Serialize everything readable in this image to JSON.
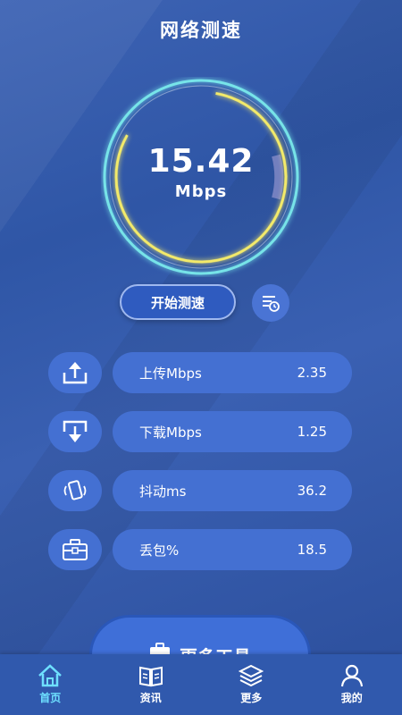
{
  "header": {
    "title": "网络测速"
  },
  "speed": {
    "value": "15.42",
    "unit": "Mbps"
  },
  "actions": {
    "start_label": "开始测速",
    "history_icon": "history-list-icon"
  },
  "metrics": [
    {
      "label": "上传Mbps",
      "value": "2.35",
      "icon": "upload-icon"
    },
    {
      "label": "下载Mbps",
      "value": "1.25",
      "icon": "download-icon"
    },
    {
      "label": "抖动ms",
      "value": "36.2",
      "icon": "vibrate-phone-icon"
    },
    {
      "label": "丢包%",
      "value": "18.5",
      "icon": "toolbox-icon"
    }
  ],
  "more_tools": {
    "label": "更多工具"
  },
  "tabs": [
    {
      "label": "首页",
      "icon": "home-icon",
      "active": true
    },
    {
      "label": "资讯",
      "icon": "book-icon",
      "active": false
    },
    {
      "label": "更多",
      "icon": "layers-icon",
      "active": false
    },
    {
      "label": "我的",
      "icon": "user-icon",
      "active": false
    }
  ],
  "colors": {
    "accent": "#6ee0ff",
    "ring_yellow": "#f3ea6a",
    "ring_cyan": "#7ff3f0",
    "button": "#4470d2"
  }
}
